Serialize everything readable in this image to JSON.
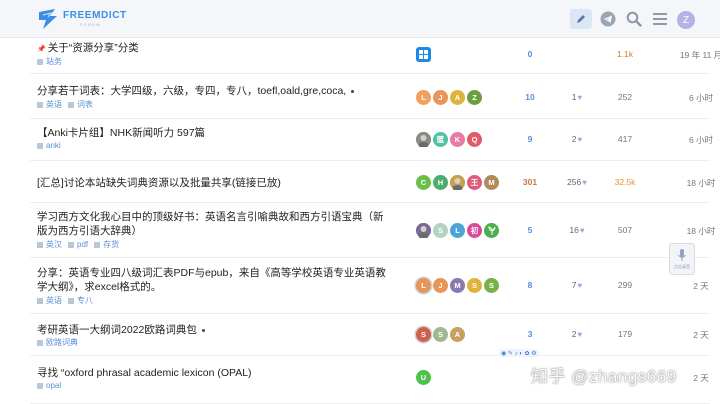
{
  "header": {
    "site_name": "FREEMDICT",
    "site_sub": "FORUM",
    "user_initial": "Z",
    "icons": [
      "edit-icon",
      "telegram-icon",
      "search-icon",
      "menu-icon"
    ]
  },
  "topics": [
    {
      "title": "关于“资源分享”分类",
      "pinned": true,
      "unread_dot": false,
      "categories": [
        "站务"
      ],
      "posters": [
        {
          "letter": "",
          "color": "#1e88e5",
          "icon": "windows-icon"
        }
      ],
      "replies": "0",
      "reply_color": "#5a8fd6",
      "likes": "",
      "views": "1.1k",
      "views_color": "#d0802a",
      "activity": "19 年 11 月"
    },
    {
      "title": "分享若干词表：大学四级，六级，专四，专八，toefl,oald,gre,coca,",
      "pinned": false,
      "unread_dot": true,
      "categories": [
        "英语",
        "词表"
      ],
      "posters": [
        {
          "letter": "L",
          "color": "#f0a060"
        },
        {
          "letter": "J",
          "color": "#e8955a"
        },
        {
          "letter": "A",
          "color": "#e0b43c"
        },
        {
          "letter": "Z",
          "color": "#6b9e40"
        }
      ],
      "replies": "10",
      "reply_color": "#5a8fd6",
      "likes": "1",
      "views": "252",
      "views_color": "#777777",
      "activity": "6 小时"
    },
    {
      "title": "【Anki卡片组】NHK新闻听力 597篇",
      "pinned": false,
      "unread_dot": false,
      "categories": [
        "anki"
      ],
      "posters": [
        {
          "letter": "",
          "color": "#8a8a8a",
          "icon": "photo-avatar"
        },
        {
          "letter": "匿",
          "color": "#53c2a4"
        },
        {
          "letter": "K",
          "color": "#e87aa4"
        },
        {
          "letter": "Q",
          "color": "#e05a6a"
        }
      ],
      "replies": "9",
      "reply_color": "#5a8fd6",
      "likes": "2",
      "views": "417",
      "views_color": "#777777",
      "activity": "6 小时"
    },
    {
      "title": "[汇总]讨论本站缺失词典资源以及批量共享(链接已放)",
      "pinned": false,
      "unread_dot": false,
      "categories": [],
      "posters": [
        {
          "letter": "C",
          "color": "#6abf4b"
        },
        {
          "letter": "H",
          "color": "#4cae6e"
        },
        {
          "letter": "",
          "color": "#c9a04a",
          "icon": "photo-avatar"
        },
        {
          "letter": "王",
          "color": "#e05a7a"
        },
        {
          "letter": "M",
          "color": "#b08a5a"
        }
      ],
      "replies": "301",
      "reply_color": "#c9774a",
      "likes": "256",
      "views": "32.5k",
      "views_color": "#e6932f",
      "activity": "18 小时"
    },
    {
      "title": "学习西方文化我心目中的顶级好书：英语名言引喻典故和西方引语宝典（新版为西方引语大辞典）",
      "pinned": false,
      "unread_dot": false,
      "categories": [
        "英汉",
        "pdf",
        "存货"
      ],
      "posters": [
        {
          "letter": "",
          "color": "#7a6a9a",
          "icon": "photo-avatar"
        },
        {
          "letter": "S",
          "color": "#b4d3c4"
        },
        {
          "letter": "L",
          "color": "#4aa6d8"
        },
        {
          "letter": "初",
          "color": "#d84a9a"
        },
        {
          "letter": "",
          "color": "#4cae4c",
          "icon": "leaf-avatar"
        }
      ],
      "replies": "5",
      "reply_color": "#5a8fd6",
      "likes": "16",
      "views": "507",
      "views_color": "#777777",
      "activity": "18 小时"
    },
    {
      "title": "分享：英语专业四八级词汇表PDF与epub，来自《高等学校英语专业英语教学大纲》，求excel格式的。",
      "pinned": false,
      "unread_dot": false,
      "categories": [
        "英语",
        "专八"
      ],
      "posters": [
        {
          "letter": "L",
          "color": "#e8955a",
          "ring": true
        },
        {
          "letter": "J",
          "color": "#e8955a"
        },
        {
          "letter": "M",
          "color": "#8a7ab0"
        },
        {
          "letter": "S",
          "color": "#e0b43c"
        },
        {
          "letter": "S",
          "color": "#7ab04a"
        }
      ],
      "replies": "8",
      "reply_color": "#5a8fd6",
      "likes": "7",
      "views": "299",
      "views_color": "#777777",
      "activity": "2 天"
    },
    {
      "title": "考研英语一大纲词2022欧路词典包",
      "pinned": false,
      "unread_dot": true,
      "categories": [
        "欧路词典"
      ],
      "posters": [
        {
          "letter": "S",
          "color": "#d0604a",
          "ring": true
        },
        {
          "letter": "S",
          "color": "#a0b890"
        },
        {
          "letter": "A",
          "color": "#c9a060"
        }
      ],
      "replies": "3",
      "reply_color": "#5a8fd6",
      "likes": "2",
      "views": "179",
      "views_color": "#777777",
      "activity": "2 天"
    },
    {
      "title": "寻找 “oxford phrasal academic lexicon (OPAL)",
      "pinned": false,
      "unread_dot": false,
      "categories": [
        "opal"
      ],
      "posters": [
        {
          "letter": "U",
          "color": "#4cc24c"
        }
      ],
      "replies": "",
      "reply_color": "#5a8fd6",
      "likes": "",
      "views": "",
      "views_color": "#777777",
      "activity": "2 天"
    }
  ],
  "watermark": "知乎 @zhangs669",
  "mic_widget_label": "点击录音"
}
